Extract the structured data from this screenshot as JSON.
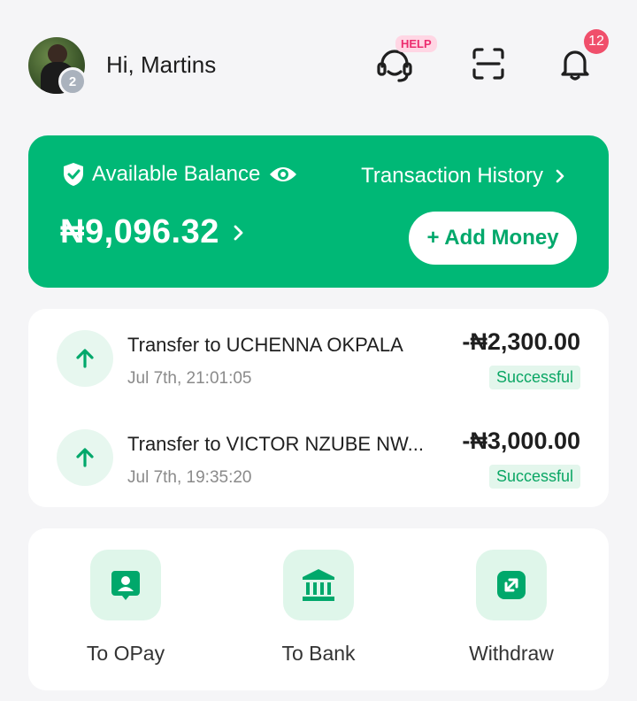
{
  "header": {
    "greeting": "Hi, Martins",
    "level_badge": "2",
    "help_tag": "HELP",
    "notification_count": "12",
    "icons": {
      "help": "headset-icon",
      "scan": "scan-icon",
      "notifications": "bell-icon"
    }
  },
  "balance_card": {
    "label": "Available Balance",
    "amount": "₦9,096.32",
    "history_link": "Transaction History",
    "add_money": "+ Add Money",
    "color": "#00b876"
  },
  "transactions": [
    {
      "title": "Transfer to UCHENNA OKPALA",
      "date": "Jul 7th, 21:01:05",
      "amount": "-₦2,300.00",
      "status": "Successful"
    },
    {
      "title": "Transfer to VICTOR NZUBE NW...",
      "date": "Jul 7th, 19:35:20",
      "amount": "-₦3,000.00",
      "status": "Successful"
    }
  ],
  "actions": [
    {
      "label": "To OPay",
      "icon": "opay-user-icon"
    },
    {
      "label": "To Bank",
      "icon": "bank-icon"
    },
    {
      "label": "Withdraw",
      "icon": "withdraw-icon"
    }
  ],
  "colors": {
    "accent": "#00b876",
    "badge": "#f04f6b",
    "help": "#ec2d6f"
  }
}
